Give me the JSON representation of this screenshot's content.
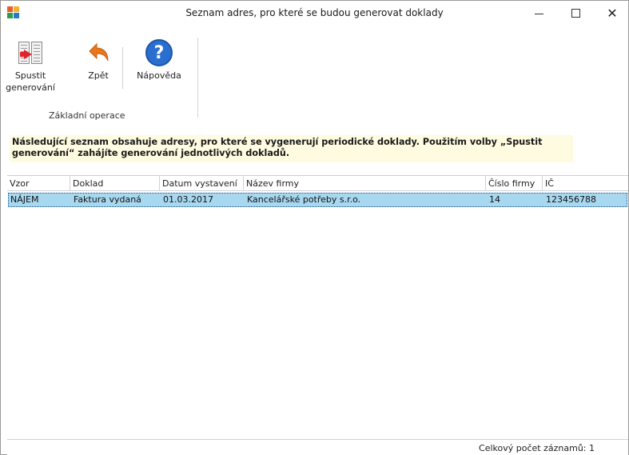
{
  "window": {
    "title": "Seznam adres, pro které se budou generovat doklady",
    "minimize_glyph": "—",
    "maximize_glyph": "☐",
    "close_glyph": "✕"
  },
  "ribbon": {
    "buttons": [
      {
        "icon": "generate-documents-icon",
        "label_line1": "Spustit",
        "label_line2": "generování"
      },
      {
        "icon": "back-arrow-icon",
        "label": "Zpět"
      },
      {
        "icon": "help-icon",
        "label": "Nápověda",
        "glyph": "?"
      }
    ],
    "group_label": "Základní operace"
  },
  "info": {
    "text": "Následující seznam obsahuje adresy, pro které se vygenerují periodické doklady. Použitím volby „Spustit generování“ zahájíte generování jednotlivých dokladů."
  },
  "grid": {
    "columns": [
      "Vzor",
      "Doklad",
      "Datum vystavení",
      "Název firmy",
      "Číslo firmy",
      "IČ"
    ],
    "rows": [
      {
        "vzor": "NÁJEM",
        "doklad": "Faktura vydaná",
        "datum": "01.03.2017",
        "nazev": "Kancelářské potřeby s.r.o.",
        "cislo": "14",
        "ic": "123456788"
      }
    ]
  },
  "status": {
    "text": "Celkový počet záznamů:  1"
  },
  "colors": {
    "selected_row": "#a8d8f0",
    "info_background": "#fffbe0",
    "help_blue": "#2a6fd0",
    "back_orange": "#e8761e",
    "arrow_red": "#e0252b"
  }
}
